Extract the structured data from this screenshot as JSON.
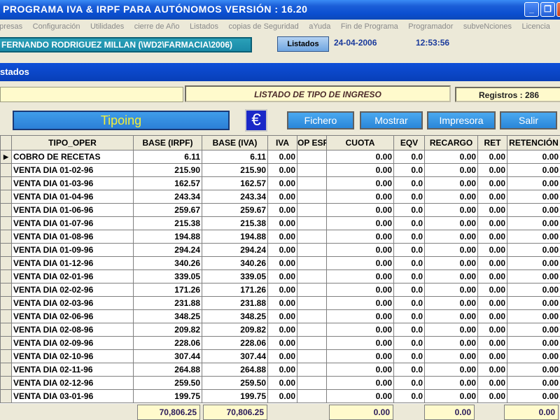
{
  "window": {
    "title": "PROGRAMA IVA & IRPF PARA AUTÓNOMOS  VERSIÓN : 16.20"
  },
  "menu": [
    "mpresas",
    "Configuración",
    "Utilidades",
    "cierre de Año",
    "Listados",
    "copias de Seguridad",
    "aYuda",
    "Fin de Programa",
    "Programador",
    "subveNciones",
    "Licencia"
  ],
  "info": {
    "user": "FERNANDO RODRIGUEZ MILLAN  (\\WD2\\FARMACIA\\2006)",
    "listados_label": "Listados",
    "date": "24-04-2006",
    "time": "12:53:56"
  },
  "section": {
    "title": "stados"
  },
  "report": {
    "title": "LISTADO DE TIPO DE INGRESO",
    "registros": "Registros : 286"
  },
  "toolbar": {
    "tipoing": "Tipoing",
    "euro": "€",
    "fichero": "Fichero",
    "mostrar": "Mostrar",
    "impresora": "Impresora",
    "salir": "Salir"
  },
  "table": {
    "columns": [
      "TIPO_OPER",
      "BASE (IRPF)",
      "BASE (IVA)",
      "IVA",
      "OP ESP",
      "CUOTA",
      "EQV",
      "RECARGO",
      "RET",
      "RETENCIÓN"
    ],
    "rows": [
      [
        "COBRO DE RECETAS",
        "6.11",
        "6.11",
        "0.00",
        "",
        "0.00",
        "0.0",
        "0.00",
        "0.00",
        "0.00"
      ],
      [
        "VENTA DIA 01-02-96",
        "215.90",
        "215.90",
        "0.00",
        "",
        "0.00",
        "0.0",
        "0.00",
        "0.00",
        "0.00"
      ],
      [
        "VENTA DIA 01-03-96",
        "162.57",
        "162.57",
        "0.00",
        "",
        "0.00",
        "0.0",
        "0.00",
        "0.00",
        "0.00"
      ],
      [
        "VENTA DIA 01-04-96",
        "243.34",
        "243.34",
        "0.00",
        "",
        "0.00",
        "0.0",
        "0.00",
        "0.00",
        "0.00"
      ],
      [
        "VENTA DIA 01-06-96",
        "259.67",
        "259.67",
        "0.00",
        "",
        "0.00",
        "0.0",
        "0.00",
        "0.00",
        "0.00"
      ],
      [
        "VENTA DIA 01-07-96",
        "215.38",
        "215.38",
        "0.00",
        "",
        "0.00",
        "0.0",
        "0.00",
        "0.00",
        "0.00"
      ],
      [
        "VENTA DIA 01-08-96",
        "194.88",
        "194.88",
        "0.00",
        "",
        "0.00",
        "0.0",
        "0.00",
        "0.00",
        "0.00"
      ],
      [
        "VENTA DIA 01-09-96",
        "294.24",
        "294.24",
        "0.00",
        "",
        "0.00",
        "0.0",
        "0.00",
        "0.00",
        "0.00"
      ],
      [
        "VENTA DIA 01-12-96",
        "340.26",
        "340.26",
        "0.00",
        "",
        "0.00",
        "0.0",
        "0.00",
        "0.00",
        "0.00"
      ],
      [
        "VENTA DIA 02-01-96",
        "339.05",
        "339.05",
        "0.00",
        "",
        "0.00",
        "0.0",
        "0.00",
        "0.00",
        "0.00"
      ],
      [
        "VENTA DIA 02-02-96",
        "171.26",
        "171.26",
        "0.00",
        "",
        "0.00",
        "0.0",
        "0.00",
        "0.00",
        "0.00"
      ],
      [
        "VENTA DIA 02-03-96",
        "231.88",
        "231.88",
        "0.00",
        "",
        "0.00",
        "0.0",
        "0.00",
        "0.00",
        "0.00"
      ],
      [
        "VENTA DIA 02-06-96",
        "348.25",
        "348.25",
        "0.00",
        "",
        "0.00",
        "0.0",
        "0.00",
        "0.00",
        "0.00"
      ],
      [
        "VENTA DIA 02-08-96",
        "209.82",
        "209.82",
        "0.00",
        "",
        "0.00",
        "0.0",
        "0.00",
        "0.00",
        "0.00"
      ],
      [
        "VENTA DIA 02-09-96",
        "228.06",
        "228.06",
        "0.00",
        "",
        "0.00",
        "0.0",
        "0.00",
        "0.00",
        "0.00"
      ],
      [
        "VENTA DIA 02-10-96",
        "307.44",
        "307.44",
        "0.00",
        "",
        "0.00",
        "0.0",
        "0.00",
        "0.00",
        "0.00"
      ],
      [
        "VENTA DIA 02-11-96",
        "264.88",
        "264.88",
        "0.00",
        "",
        "0.00",
        "0.0",
        "0.00",
        "0.00",
        "0.00"
      ],
      [
        "VENTA DIA 02-12-96",
        "259.50",
        "259.50",
        "0.00",
        "",
        "0.00",
        "0.0",
        "0.00",
        "0.00",
        "0.00"
      ],
      [
        "VENTA DIA 03-01-96",
        "199.75",
        "199.75",
        "0.00",
        "",
        "0.00",
        "0.0",
        "0.00",
        "0.00",
        "0.00"
      ]
    ]
  },
  "totals": {
    "base_irpf": "70,806.25",
    "base_iva": "70,806.25",
    "cuota": "0.00",
    "recargo": "0.00",
    "retencion": "0.00"
  }
}
